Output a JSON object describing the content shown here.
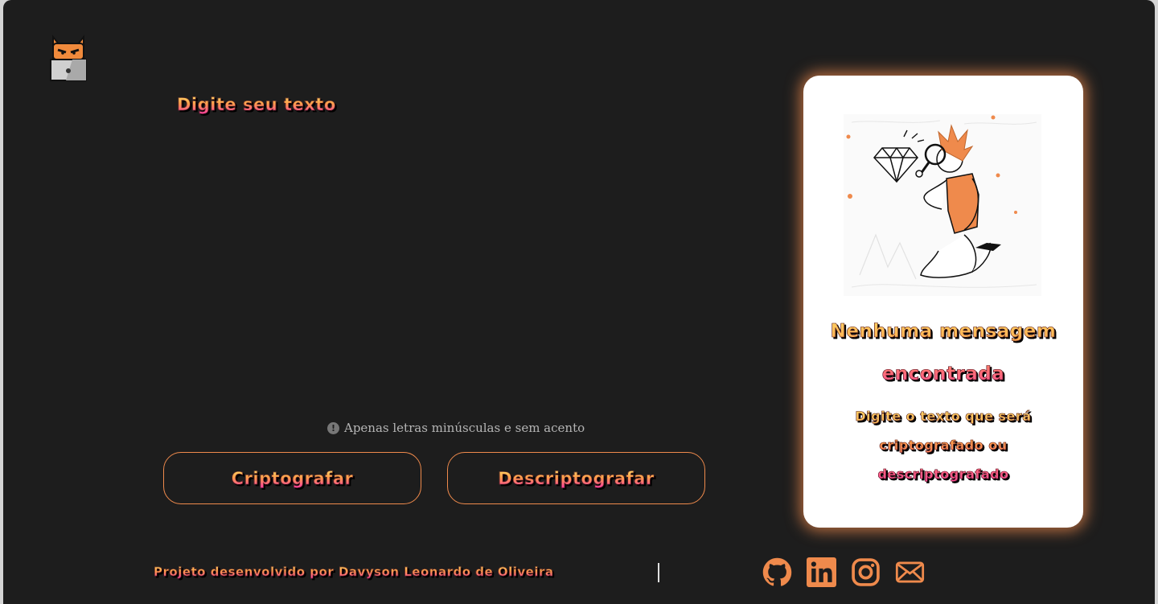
{
  "input": {
    "label": "Digite seu texto",
    "value": "",
    "hint": "Apenas letras minúsculas e sem acento",
    "hint_icon": "exclamation-circle-icon"
  },
  "buttons": {
    "encrypt_label": "Criptografar",
    "decrypt_label": "Descriptografar"
  },
  "output": {
    "title": "Nenhuma mensagem encontrada",
    "description": "Digite o texto que será criptografado ou descriptografado"
  },
  "footer": {
    "credit": "Projeto desenvolvido por Davyson Leonardo de Oliveira",
    "social_icons": [
      "github-icon",
      "linkedin-icon",
      "instagram-icon",
      "email-icon"
    ]
  },
  "colors": {
    "background": "#1d1d1d",
    "accent": "#ef8a4c",
    "panel": "#ffffff",
    "text_gradient": [
      "#ffe36b",
      "#ff9f4a",
      "#ff3ea5"
    ]
  }
}
